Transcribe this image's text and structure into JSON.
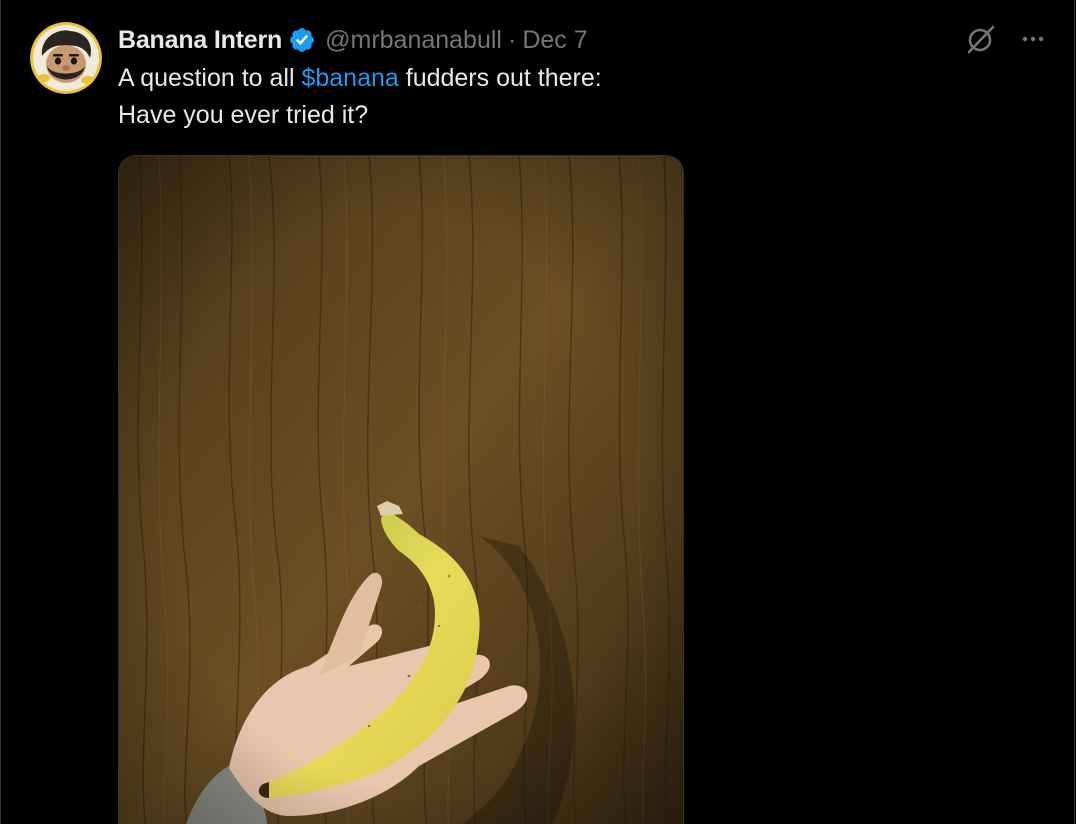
{
  "tweet": {
    "author": {
      "display_name": "Banana Intern",
      "handle": "@mrbananabull",
      "verified": true,
      "avatar_icon": "cartoon-avatar"
    },
    "separator": "·",
    "date": "Dec 7",
    "text": {
      "before": "A question to all ",
      "cashtag": "$banana",
      "after": " fudders out there:",
      "line2": "Have you ever tried it?"
    },
    "media": {
      "kind": "photo",
      "subject": "hand-holding-banana-on-wood"
    },
    "actions": {
      "grok_icon": "slashed-circle-icon",
      "more_icon": "more-dots-icon"
    }
  },
  "colors": {
    "background": "#000000",
    "text_primary": "#e7e9ea",
    "text_secondary": "#71767b",
    "link": "#1d9bf0",
    "verified_badge": "#1d9bf0",
    "border": "#2f3336"
  }
}
